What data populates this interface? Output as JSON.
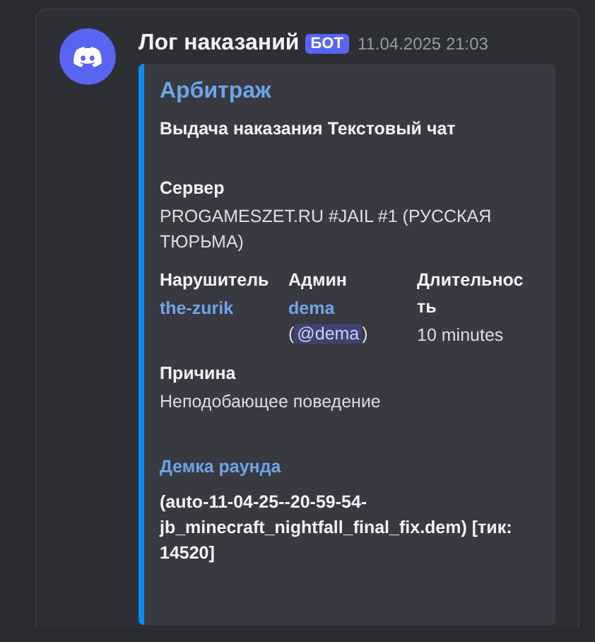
{
  "message": {
    "author": "Лог наказаний",
    "badge": "БОТ",
    "timestamp": "11.04.2025 21:03",
    "embed": {
      "title": "Арбитраж",
      "description": "Выдача наказания Текстовый чат",
      "fields": [
        {
          "name": "Сервер",
          "inline": false,
          "value": [
            {
              "kind": "text",
              "text": "PROGAMESZET.RU #JAIL #1 (РУССКАЯ ТЮРЬМА)"
            }
          ]
        },
        {
          "name": "Нарушитель",
          "inline": true,
          "value": [
            {
              "kind": "link",
              "text": "the-zurik"
            }
          ]
        },
        {
          "name": "Админ",
          "inline": true,
          "value": [
            {
              "kind": "link",
              "text": "dema"
            },
            {
              "kind": "break"
            },
            {
              "kind": "text",
              "text": "("
            },
            {
              "kind": "mention",
              "text": "@dema"
            },
            {
              "kind": "text",
              "text": ")"
            }
          ]
        },
        {
          "name": "Длительность",
          "inline": true,
          "value": [
            {
              "kind": "text",
              "text": "10 minutes"
            }
          ]
        },
        {
          "name": "Причина",
          "inline": false,
          "value": [
            {
              "kind": "text",
              "text": "Неподобающее поведение"
            }
          ]
        }
      ],
      "link_section": {
        "title": "Демка раунда",
        "text": "(auto-11-04-25--20-59-54-jb_minecraft_nightfall_final_fix.dem) [тик: 14520]"
      }
    }
  }
}
